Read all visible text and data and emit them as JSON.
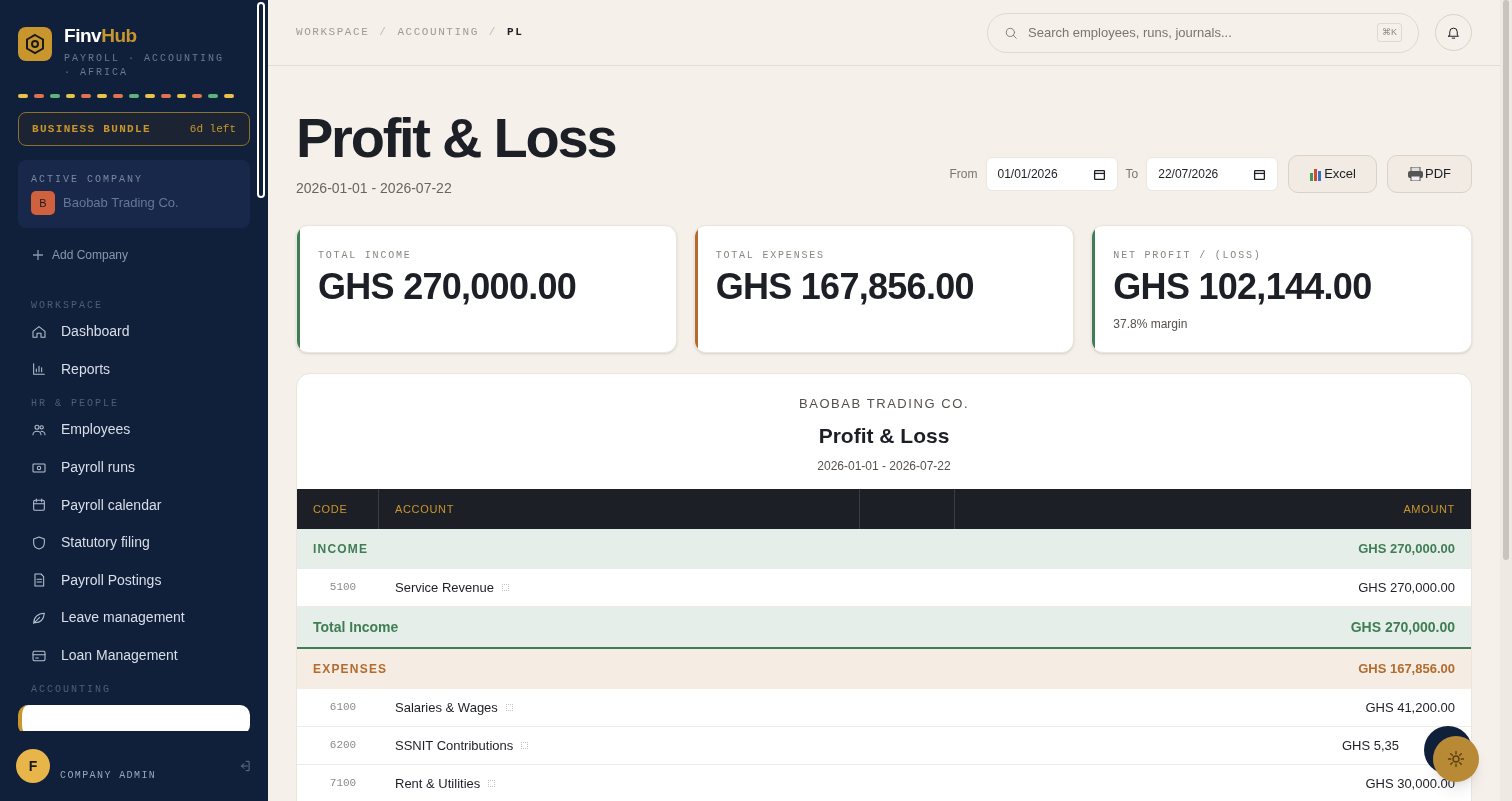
{
  "sidebar": {
    "brand": {
      "name_start": "Finv",
      "name_end": "Hub",
      "tagline": "PAYROLL · ACCOUNTING · AFRICA"
    },
    "plan": {
      "name": "BUSINESS BUNDLE",
      "remaining": "6d left"
    },
    "active_company": {
      "label": "ACTIVE COMPANY",
      "initial": "B",
      "name": "Baobab Trading Co."
    },
    "add_company": "Add Company",
    "sections": [
      {
        "title": "WORKSPACE",
        "items": [
          {
            "label": "Dashboard",
            "selected": false
          },
          {
            "label": "Reports",
            "selected": false
          }
        ]
      },
      {
        "title": "HR & PEOPLE",
        "items": [
          {
            "label": "Employees",
            "selected": false
          },
          {
            "label": "Payroll runs",
            "selected": false
          },
          {
            "label": "Payroll calendar",
            "selected": false
          },
          {
            "label": "Statutory filing",
            "selected": false
          },
          {
            "label": "Payroll Postings",
            "selected": false
          },
          {
            "label": "Leave management",
            "selected": false
          },
          {
            "label": "Loan Management",
            "selected": false
          }
        ]
      },
      {
        "title": "ACCOUNTING",
        "hidden_selected_item": true
      }
    ],
    "user": {
      "initial": "F",
      "role": "COMPANY ADMIN"
    }
  },
  "header": {
    "separator": "/",
    "breadcrumbs": [
      {
        "label": "WORKSPACE",
        "current": false
      },
      {
        "label": "ACCOUNTING",
        "current": false
      },
      {
        "label": "PL",
        "current": true
      }
    ],
    "search": {
      "placeholder": "Search employees, runs, journals...",
      "shortcut": "⌘K"
    }
  },
  "page": {
    "title": "Profit & Loss",
    "range": "2026-01-01 - 2026-07-22",
    "filters": {
      "from_label": "From",
      "from_value": "01/01/2026",
      "to_label": "To",
      "to_value": "22/07/2026"
    },
    "buttons": [
      {
        "label": "Excel"
      },
      {
        "label": "PDF"
      }
    ],
    "stats": [
      {
        "label": "TOTAL INCOME",
        "value": "GHS 270,000.00",
        "color": "#3f7d55"
      },
      {
        "label": "TOTAL EXPENSES",
        "value": "GHS 167,856.00",
        "color": "#b36b2e"
      },
      {
        "label": "NET PROFIT / (LOSS)",
        "value": "GHS 102,144.00",
        "note": "37.8% margin",
        "color": "#3f7d55"
      }
    ]
  },
  "report": {
    "company": "BAOBAB TRADING CO.",
    "title": "Profit & Loss",
    "range": "2026-01-01 - 2026-07-22",
    "columns": [
      "CODE",
      "ACCOUNT",
      "AMOUNT"
    ],
    "rows": [
      {
        "kind": "section",
        "color": "#3f7d55",
        "account": "INCOME",
        "amount": "GHS 270,000.00"
      },
      {
        "kind": "item",
        "code": "5100",
        "account": "Service Revenue",
        "amount": "GHS 270,000.00"
      },
      {
        "kind": "total",
        "color": "#3f7d55",
        "account": "Total Income",
        "amount": "GHS 270,000.00"
      },
      {
        "kind": "section",
        "color": "#b36b2e",
        "account": "EXPENSES",
        "amount": "GHS 167,856.00"
      },
      {
        "kind": "item",
        "code": "6100",
        "account": "Salaries & Wages",
        "amount": "GHS 41,200.00"
      },
      {
        "kind": "item",
        "code": "6200",
        "account": "SSNIT Contributions",
        "amount": "GHS 5,35",
        "covered": true
      },
      {
        "kind": "item",
        "code": "7100",
        "account": "Rent & Utilities",
        "amount": "GHS 30,000.00"
      }
    ]
  }
}
